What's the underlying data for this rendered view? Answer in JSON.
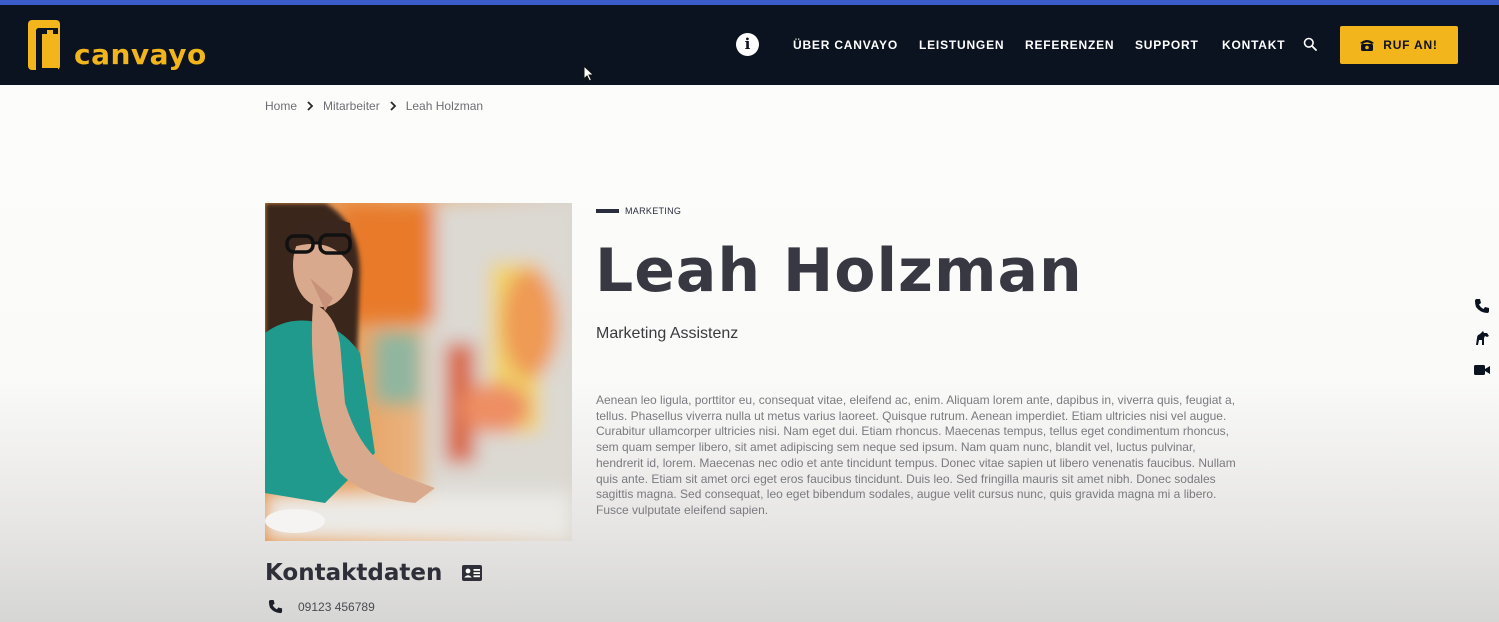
{
  "brand": {
    "name": "canvayo",
    "accent": "#f2b51b",
    "header_bg": "#0b1220",
    "top_bar": "#3b5dc9"
  },
  "header": {
    "info_glyph": "i",
    "nav": [
      {
        "label": "ÜBER CANVAYO"
      },
      {
        "label": "LEISTUNGEN"
      },
      {
        "label": "REFERENZEN"
      },
      {
        "label": "SUPPORT"
      },
      {
        "label": "KONTAKT"
      }
    ],
    "search_icon": "search-icon",
    "call_button": {
      "label": "RUF AN!",
      "icon": "phone-handset-icon"
    }
  },
  "breadcrumb": {
    "items": [
      {
        "label": "Home"
      },
      {
        "label": "Mitarbeiter"
      },
      {
        "label": "Leah Holzman"
      }
    ],
    "separator_icon": "chevron-right-icon"
  },
  "profile": {
    "department": "MARKETING",
    "name": "Leah Holzman",
    "role": "Marketing Assistenz",
    "bio": "Aenean leo ligula, porttitor eu, consequat vitae, eleifend ac, enim. Aliquam lorem ante, dapibus in, viverra quis, feugiat a, tellus. Phasellus viverra nulla ut metus varius laoreet. Quisque rutrum. Aenean imperdiet. Etiam ultricies nisi vel augue. Curabitur ullamcorper ultricies nisi. Nam eget dui. Etiam rhoncus. Maecenas tempus, tellus eget condimentum rhoncus, sem quam semper libero, sit amet adipiscing sem neque sed ipsum. Nam quam nunc, blandit vel, luctus pulvinar, hendrerit id, lorem. Maecenas nec odio et ante tincidunt tempus. Donec vitae sapien ut libero venenatis faucibus. Nullam quis ante. Etiam sit amet orci eget eros faucibus tincidunt. Duis leo. Sed fringilla mauris sit amet nibh. Donec sodales sagittis magna. Sed consequat, leo eget bibendum sodales, augue velit cursus nunc, quis gravida magna mi a libero. Fusce vulputate eleifend sapien."
  },
  "contact": {
    "title": "Kontaktdaten",
    "title_icon": "id-card-icon",
    "phone": "09123 456789",
    "phone_icon": "phone-icon"
  },
  "side_toolbar": [
    {
      "icon": "phone-icon"
    },
    {
      "icon": "horse-icon"
    },
    {
      "icon": "video-camera-icon"
    }
  ]
}
